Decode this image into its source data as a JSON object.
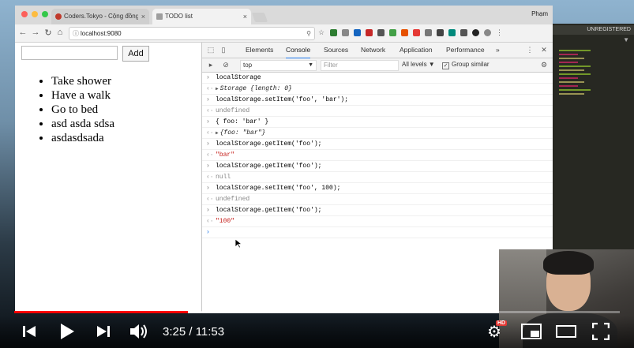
{
  "browser": {
    "tabs": [
      {
        "title": "Coders.Tokyo - Cộng đồng học",
        "favicon_color": "#c0392b"
      },
      {
        "title": "TODO list",
        "favicon_color": "#9e9e9e"
      }
    ],
    "user": "Phạm",
    "url": "localhost:9080"
  },
  "page": {
    "input_value": "",
    "add_label": "Add",
    "todos": [
      "Take shower",
      "Have a walk",
      "Go to bed",
      "asd asda sdsa",
      "asdasdsada"
    ]
  },
  "devtools": {
    "tabs": [
      "Elements",
      "Console",
      "Sources",
      "Network",
      "Application",
      "Performance"
    ],
    "active_tab": "Console",
    "more": "»",
    "context": "top",
    "filter_placeholder": "Filter",
    "levels": "All levels ▼",
    "group_similar": "Group similar",
    "console": [
      {
        "kind": "in",
        "text": "localStorage"
      },
      {
        "kind": "out",
        "expand": true,
        "text": "Storage {length: 0}",
        "style": "obj"
      },
      {
        "kind": "in",
        "text": "localStorage.setItem('foo', 'bar');"
      },
      {
        "kind": "out",
        "text": "undefined",
        "style": "undef"
      },
      {
        "kind": "in",
        "text": "{ foo: 'bar' }"
      },
      {
        "kind": "out",
        "expand": true,
        "text": "{foo: \"bar\"}",
        "style": "obj"
      },
      {
        "kind": "in",
        "text": "localStorage.getItem('foo');"
      },
      {
        "kind": "out",
        "text": "\"bar\"",
        "style": "str"
      },
      {
        "kind": "in",
        "text": "localStorage.getItem('foo');"
      },
      {
        "kind": "out",
        "text": "null",
        "style": "undef"
      },
      {
        "kind": "in",
        "text": "localStorage.setItem('foo', 100);"
      },
      {
        "kind": "out",
        "text": "undefined",
        "style": "undef"
      },
      {
        "kind": "in",
        "text": "localStorage.getItem('foo');"
      },
      {
        "kind": "out",
        "text": "\"100\"",
        "style": "str"
      }
    ]
  },
  "editor": {
    "unregistered": "UNREGISTERED"
  },
  "video": {
    "current_time": "3:25",
    "duration": "11:53",
    "progress_fraction": 0.287,
    "buffered_fraction": 0.61,
    "time_display": "3:25 / 11:53",
    "hd_badge": "HD"
  },
  "colors": {
    "progress": "#ff0000",
    "accent": "#1a73e8",
    "string": "#c41a16"
  }
}
